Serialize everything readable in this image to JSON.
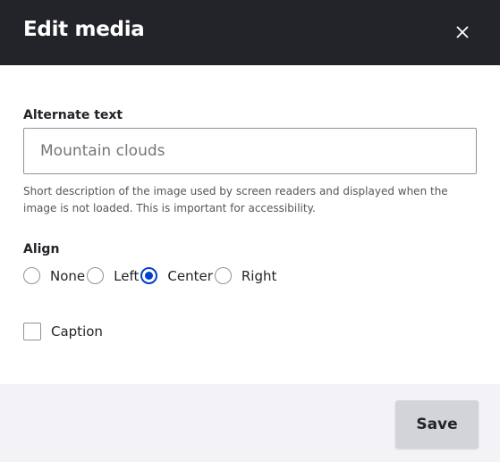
{
  "dialog": {
    "title": "Edit media",
    "close_icon": "close-icon"
  },
  "form": {
    "alt_text": {
      "label": "Alternate text",
      "value": "",
      "placeholder": "Mountain clouds",
      "description": "Short description of the image used by screen readers and displayed when the image is not loaded. This is important for accessibility."
    },
    "align": {
      "label": "Align",
      "options": [
        {
          "label": "None",
          "checked": false
        },
        {
          "label": "Left",
          "checked": false
        },
        {
          "label": "Center",
          "checked": true
        },
        {
          "label": "Right",
          "checked": false
        }
      ],
      "selected": "Center"
    },
    "caption": {
      "label": "Caption",
      "checked": false
    }
  },
  "footer": {
    "save_label": "Save"
  },
  "colors": {
    "header_bg": "#232429",
    "accent": "#003ecc",
    "footer_bg": "#f2f2f7",
    "button_bg": "#d3d4d9"
  }
}
